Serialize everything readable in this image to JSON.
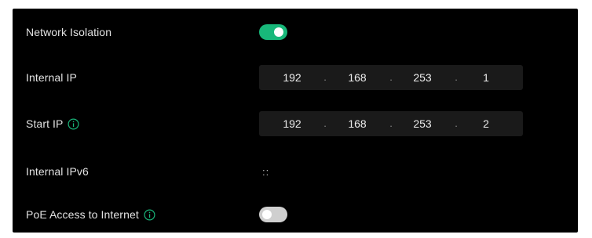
{
  "rows": {
    "network_isolation": {
      "label": "Network Isolation",
      "enabled": true
    },
    "internal_ip": {
      "label": "Internal IP",
      "octets": [
        "192",
        "168",
        "253",
        "1"
      ]
    },
    "start_ip": {
      "label": "Start IP",
      "octets": [
        "192",
        "168",
        "253",
        "2"
      ]
    },
    "internal_ipv6": {
      "label": "Internal IPv6",
      "value": "::"
    },
    "poe_access": {
      "label": "PoE Access to Internet",
      "enabled": false
    }
  },
  "separator": ".",
  "colors": {
    "toggle_on": "#18b87a",
    "toggle_off": "#cfcfcf",
    "info_icon": "#19b57a",
    "panel_bg": "#000000",
    "input_bg": "#1a1a1a"
  }
}
